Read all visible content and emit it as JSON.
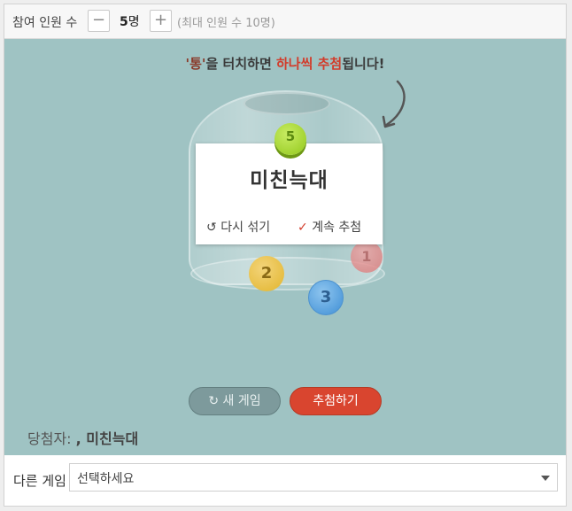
{
  "header": {
    "participants_label": "참여 인원 수",
    "count_value": "5",
    "count_unit": "명",
    "max_note": "(최대 인원 수 10명)"
  },
  "instruction": {
    "quote_word": "'통'",
    "part1": "을 터치하면 ",
    "highlight": "하나씩 추첨",
    "part2": "됩니다!"
  },
  "balls": [
    "1",
    "2",
    "3",
    "5"
  ],
  "result_card": {
    "winner_name": "미친늑대",
    "reshuffle_label": "다시 섞기",
    "continue_label": "계속 추첨"
  },
  "actions": {
    "new_game_label": "새 게임",
    "draw_label": "추첨하기"
  },
  "winners": {
    "label": "당첨자:",
    "list": ", 미친늑대"
  },
  "footer": {
    "other_game_label": "다른 게임",
    "select_value": "선택하세요"
  },
  "colors": {
    "stage_bg": "#9fc3c3",
    "accent_red": "#d9452f",
    "new_game_btn": "#7d9a9c"
  }
}
